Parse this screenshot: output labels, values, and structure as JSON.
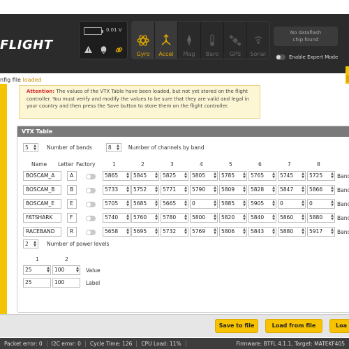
{
  "header": {
    "logo": "FLIGHT",
    "voltage": "0.01 V",
    "sensors": [
      {
        "label": "Gyro",
        "icon": "gyro-icon",
        "active": true
      },
      {
        "label": "Accel",
        "icon": "accel-icon",
        "active": true
      },
      {
        "label": "Mag",
        "icon": "mag-icon",
        "active": false
      },
      {
        "label": "Baro",
        "icon": "baro-icon",
        "active": false
      },
      {
        "label": "GPS",
        "icon": "gps-icon",
        "active": false
      },
      {
        "label": "Sonar",
        "icon": "sonar-icon",
        "active": false
      }
    ],
    "dataflash_line1": "No dataflash",
    "dataflash_line2": "chip found",
    "expert_mode_label": "Enable Expert Mode"
  },
  "log": {
    "prefix": "nfig file ",
    "status": "loaded"
  },
  "attention": {
    "label": "Attention:",
    "text": " The values of the VTX Table have been loaded, but not yet stored on the flight controller. You must verify and modify the values to be sure that they are valid and legal in your country and then press the Save button to store them on the flight controller."
  },
  "vtx": {
    "title": "VTX Table",
    "bands_count": "5",
    "bands_label": "Number of bands",
    "channels_count": "8",
    "channels_label": "Number of channels by band",
    "headers": {
      "name": "Name",
      "letter": "Letter",
      "factory": "Factory"
    },
    "channel_numbers": [
      "1",
      "2",
      "3",
      "4",
      "5",
      "6",
      "7",
      "8"
    ],
    "row_suffix": "Band",
    "bands": [
      {
        "name": "BOSCAM_A",
        "letter": "A",
        "freqs": [
          "5865",
          "5845",
          "5825",
          "5805",
          "5785",
          "5765",
          "5745",
          "5725"
        ]
      },
      {
        "name": "BOSCAM_B",
        "letter": "B",
        "freqs": [
          "5733",
          "5752",
          "5771",
          "5790",
          "5809",
          "5828",
          "5847",
          "5866"
        ]
      },
      {
        "name": "BOSCAM_E",
        "letter": "E",
        "freqs": [
          "5705",
          "5685",
          "5665",
          "0",
          "5885",
          "5905",
          "0",
          "0"
        ]
      },
      {
        "name": "FATSHARK",
        "letter": "F",
        "freqs": [
          "5740",
          "5760",
          "5780",
          "5800",
          "5820",
          "5840",
          "5860",
          "5880"
        ]
      },
      {
        "name": "RACEBAND",
        "letter": "R",
        "freqs": [
          "5658",
          "5695",
          "5732",
          "5769",
          "5806",
          "5843",
          "5880",
          "5917"
        ]
      }
    ],
    "power_levels_count": "2",
    "power_levels_label": "Number of power levels",
    "power_numbers": [
      "1",
      "2"
    ],
    "power_values": [
      "25",
      "100"
    ],
    "power_value_label": "Value",
    "power_labels": [
      "25",
      "100"
    ],
    "power_label_label": "Label"
  },
  "toolbar": {
    "save_file": "Save to file",
    "load_file": "Load from file",
    "load_clip": "Loa"
  },
  "status": {
    "packet_error": "Packet error: 0",
    "i2c_error": "I2C error: 0",
    "cycle_time": "Cycle Time: 126",
    "cpu_load": "CPU Load: 11%",
    "firmware": "Firmware: BTFL 4.1.1, Target: MATEKF405"
  },
  "colors": {
    "accent": "#f5c400",
    "header": "#2b2b2b",
    "attention": "#d32f2f"
  }
}
